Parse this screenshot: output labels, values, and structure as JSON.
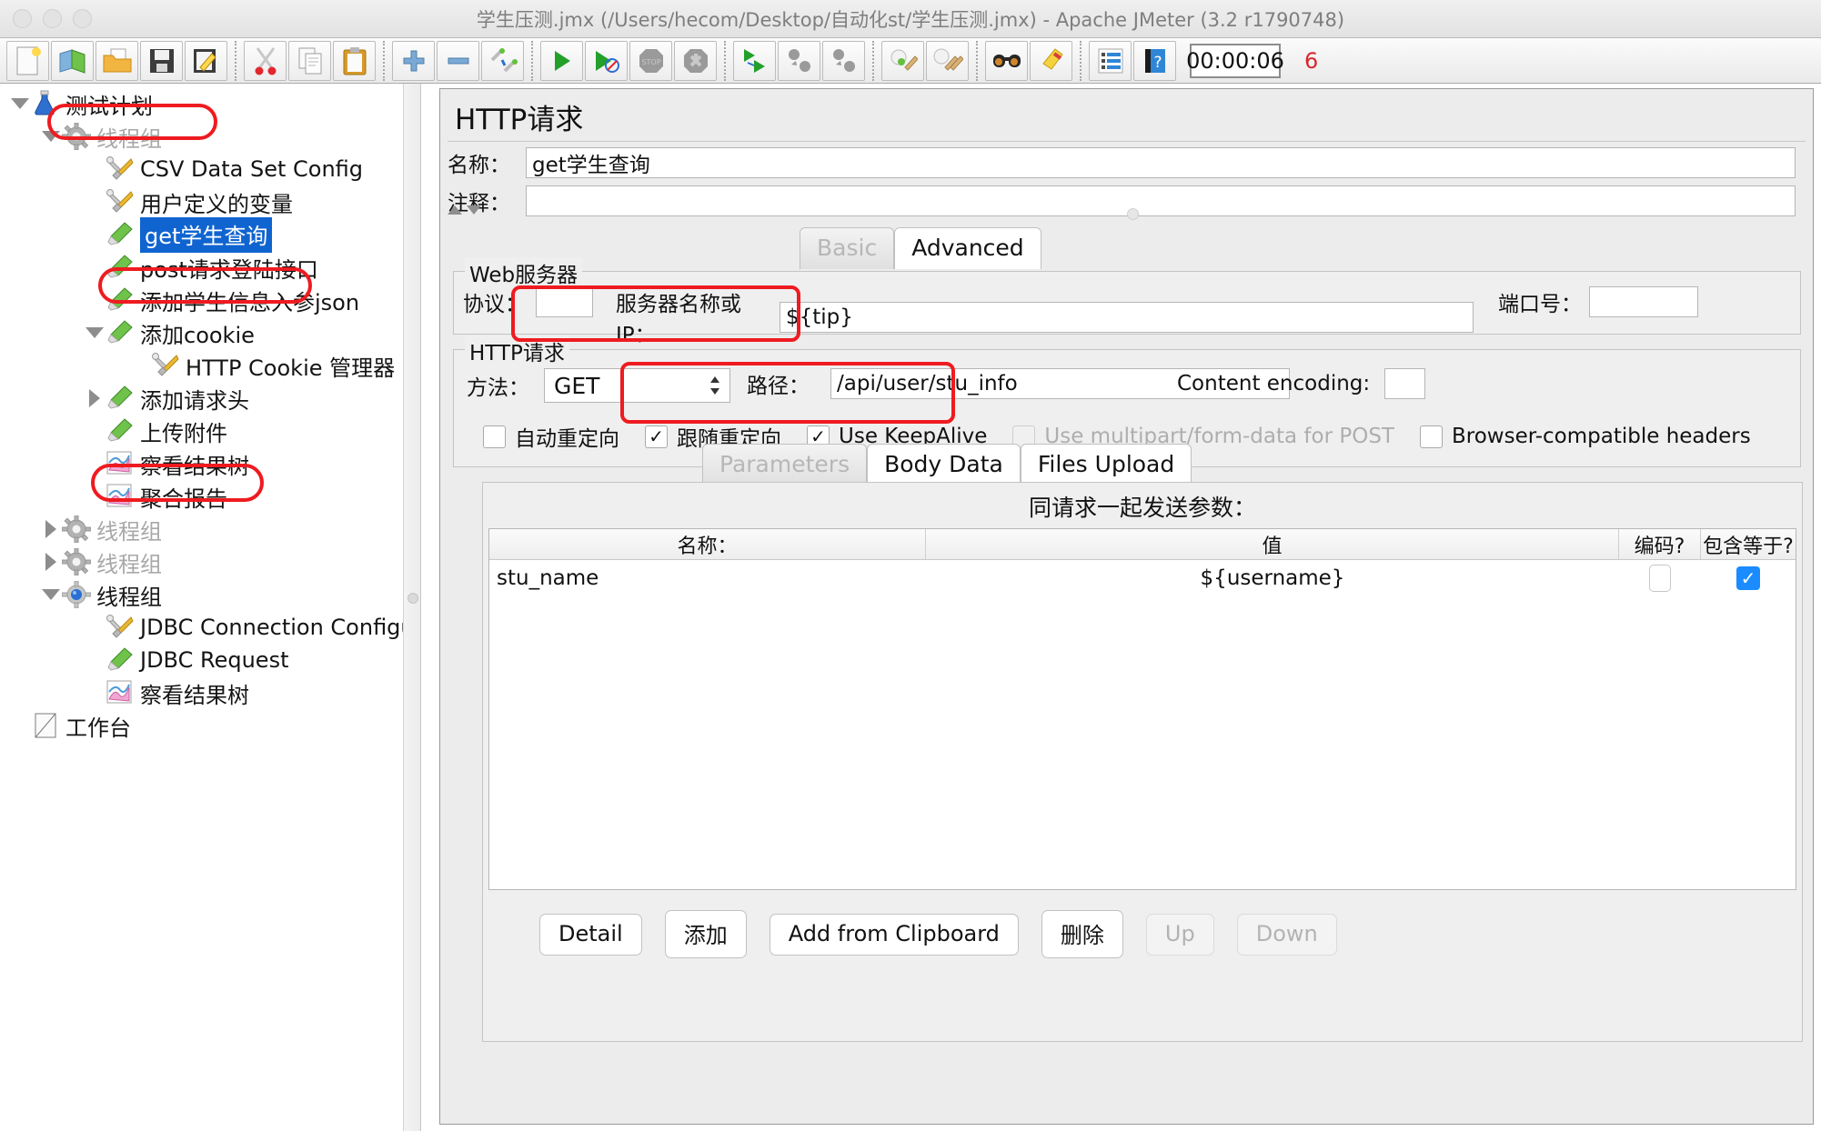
{
  "window": {
    "title": "学生压测.jmx (/Users/hecom/Desktop/自动化st/学生压测.jmx) - Apache JMeter (3.2 r1790748)",
    "accent_red": "#ee1b20",
    "selection_blue": "#1064d0"
  },
  "toolbar": {
    "buttons": [
      {
        "name": "new-icon",
        "label": "New"
      },
      {
        "name": "templates-icon",
        "label": "Templates"
      },
      {
        "name": "open-icon",
        "label": "Open"
      },
      {
        "name": "save-icon",
        "label": "Save"
      },
      {
        "name": "save-as-icon",
        "label": "Save As"
      },
      {
        "name": "cut-icon",
        "label": "Cut"
      },
      {
        "name": "copy-icon",
        "label": "Copy"
      },
      {
        "name": "paste-icon",
        "label": "Paste"
      },
      {
        "name": "expand-all-icon",
        "label": "Expand All"
      },
      {
        "name": "collapse-all-icon",
        "label": "Collapse All"
      },
      {
        "name": "toggle-icon",
        "label": "Toggle"
      },
      {
        "name": "start-icon",
        "label": "Start"
      },
      {
        "name": "start-no-pauses-icon",
        "label": "Start no pauses"
      },
      {
        "name": "stop-icon",
        "label": "Stop"
      },
      {
        "name": "shutdown-icon",
        "label": "Shutdown"
      },
      {
        "name": "remote-start-all-icon",
        "label": "Remote Start All"
      },
      {
        "name": "remote-stop-all-icon",
        "label": "Remote Stop All"
      },
      {
        "name": "remote-shutdown-all-icon",
        "label": "Remote Shutdown All"
      },
      {
        "name": "clear-icon",
        "label": "Clear"
      },
      {
        "name": "clear-all-icon",
        "label": "Clear All"
      },
      {
        "name": "search-icon",
        "label": "Search"
      },
      {
        "name": "reset-search-icon",
        "label": "Reset Search"
      },
      {
        "name": "function-helper-icon",
        "label": "Function Helper Dialog"
      },
      {
        "name": "help-icon",
        "label": "Help"
      }
    ],
    "timer": "00:00:06",
    "thread_count": "6"
  },
  "tree": {
    "nodes": [
      {
        "label": "测试计划",
        "icon": "test-plan-icon",
        "depth": 0,
        "twist": "down",
        "dim": false,
        "selected": false
      },
      {
        "label": "线程组",
        "icon": "thread-group-icon",
        "depth": 1,
        "twist": "down",
        "dim": true,
        "selected": false
      },
      {
        "label": "CSV Data Set Config",
        "icon": "config-element-icon",
        "depth": 2,
        "twist": "none",
        "dim": false,
        "selected": false
      },
      {
        "label": "用户定义的变量",
        "icon": "config-element-icon",
        "depth": 2,
        "twist": "none",
        "dim": false,
        "selected": false
      },
      {
        "label": "get学生查询",
        "icon": "sampler-icon",
        "depth": 2,
        "twist": "none",
        "dim": false,
        "selected": true
      },
      {
        "label": "post请求登陆接口",
        "icon": "sampler-icon",
        "depth": 2,
        "twist": "none",
        "dim": false,
        "selected": false
      },
      {
        "label": "添加学生信息入参json",
        "icon": "sampler-icon",
        "depth": 2,
        "twist": "none",
        "dim": false,
        "selected": false
      },
      {
        "label": "添加cookie",
        "icon": "sampler-icon",
        "depth": 2,
        "twist": "down",
        "dim": false,
        "selected": false
      },
      {
        "label": "HTTP Cookie 管理器",
        "icon": "config-element-icon",
        "depth": 3,
        "twist": "none",
        "dim": false,
        "selected": false
      },
      {
        "label": "添加请求头",
        "icon": "sampler-icon",
        "depth": 2,
        "twist": "right",
        "dim": false,
        "selected": false
      },
      {
        "label": "上传附件",
        "icon": "sampler-icon",
        "depth": 2,
        "twist": "none",
        "dim": false,
        "selected": false
      },
      {
        "label": "察看结果树",
        "icon": "listener-icon",
        "depth": 2,
        "twist": "none",
        "dim": false,
        "selected": false
      },
      {
        "label": "聚合报告",
        "icon": "listener-icon",
        "depth": 2,
        "twist": "none",
        "dim": false,
        "selected": false
      },
      {
        "label": "线程组",
        "icon": "thread-group-icon",
        "depth": 1,
        "twist": "right",
        "dim": true,
        "selected": false
      },
      {
        "label": "线程组",
        "icon": "thread-group-icon",
        "depth": 1,
        "twist": "right",
        "dim": true,
        "selected": false
      },
      {
        "label": "线程组",
        "icon": "thread-group-active-icon",
        "depth": 1,
        "twist": "down",
        "dim": false,
        "selected": false
      },
      {
        "label": "JDBC Connection Configu",
        "icon": "config-element-icon",
        "depth": 2,
        "twist": "none",
        "dim": false,
        "selected": false
      },
      {
        "label": "JDBC Request",
        "icon": "sampler-icon",
        "depth": 2,
        "twist": "none",
        "dim": false,
        "selected": false
      },
      {
        "label": "察看结果树",
        "icon": "listener-icon",
        "depth": 2,
        "twist": "none",
        "dim": false,
        "selected": false
      },
      {
        "label": "工作台",
        "icon": "workbench-icon",
        "depth": 0,
        "twist": "none",
        "dim": false,
        "selected": false
      }
    ]
  },
  "main": {
    "panel_title": "HTTP请求",
    "name_label": "名称：",
    "name_value": "get学生查询",
    "comment_label": "注释：",
    "comment_value": "",
    "mode_tabs": [
      {
        "label": "Basic",
        "active": false
      },
      {
        "label": "Advanced",
        "active": true
      }
    ],
    "web_server": {
      "legend": "Web服务器",
      "protocol_label": "协议：",
      "protocol_value": "",
      "server_label": "服务器名称或IP：",
      "server_value": "${tip}",
      "port_label": "端口号：",
      "port_value": ""
    },
    "http_request": {
      "legend": "HTTP请求",
      "method_label": "方法：",
      "method_value": "GET",
      "path_label": "路径：",
      "path_value": "/api/user/stu_info",
      "content_encoding_label": "Content encoding:",
      "content_encoding_value": "",
      "checkboxes": [
        {
          "label": "自动重定向",
          "checked": false,
          "disabled": false
        },
        {
          "label": "跟随重定向",
          "checked": true,
          "disabled": false
        },
        {
          "label": "Use KeepAlive",
          "checked": true,
          "disabled": false
        },
        {
          "label": "Use multipart/form-data for POST",
          "checked": false,
          "disabled": true
        },
        {
          "label": "Browser-compatible headers",
          "checked": false,
          "disabled": false
        }
      ]
    },
    "param_tabs": [
      {
        "label": "Parameters",
        "active": false
      },
      {
        "label": "Body Data",
        "active": true
      },
      {
        "label": "Files Upload",
        "active": true
      }
    ],
    "params_caption": "同请求一起发送参数：",
    "params_table": {
      "columns": [
        "名称：",
        "值",
        "编码?",
        "包含等于?"
      ],
      "rows": [
        {
          "name": "stu_name",
          "value": "${username}",
          "encode": false,
          "include_equals": true
        }
      ]
    },
    "buttons": [
      {
        "label": "Detail",
        "disabled": false
      },
      {
        "label": "添加",
        "disabled": false
      },
      {
        "label": "Add from Clipboard",
        "disabled": false
      },
      {
        "label": "删除",
        "disabled": false
      },
      {
        "label": "Up",
        "disabled": true
      },
      {
        "label": "Down",
        "disabled": true
      }
    ]
  }
}
